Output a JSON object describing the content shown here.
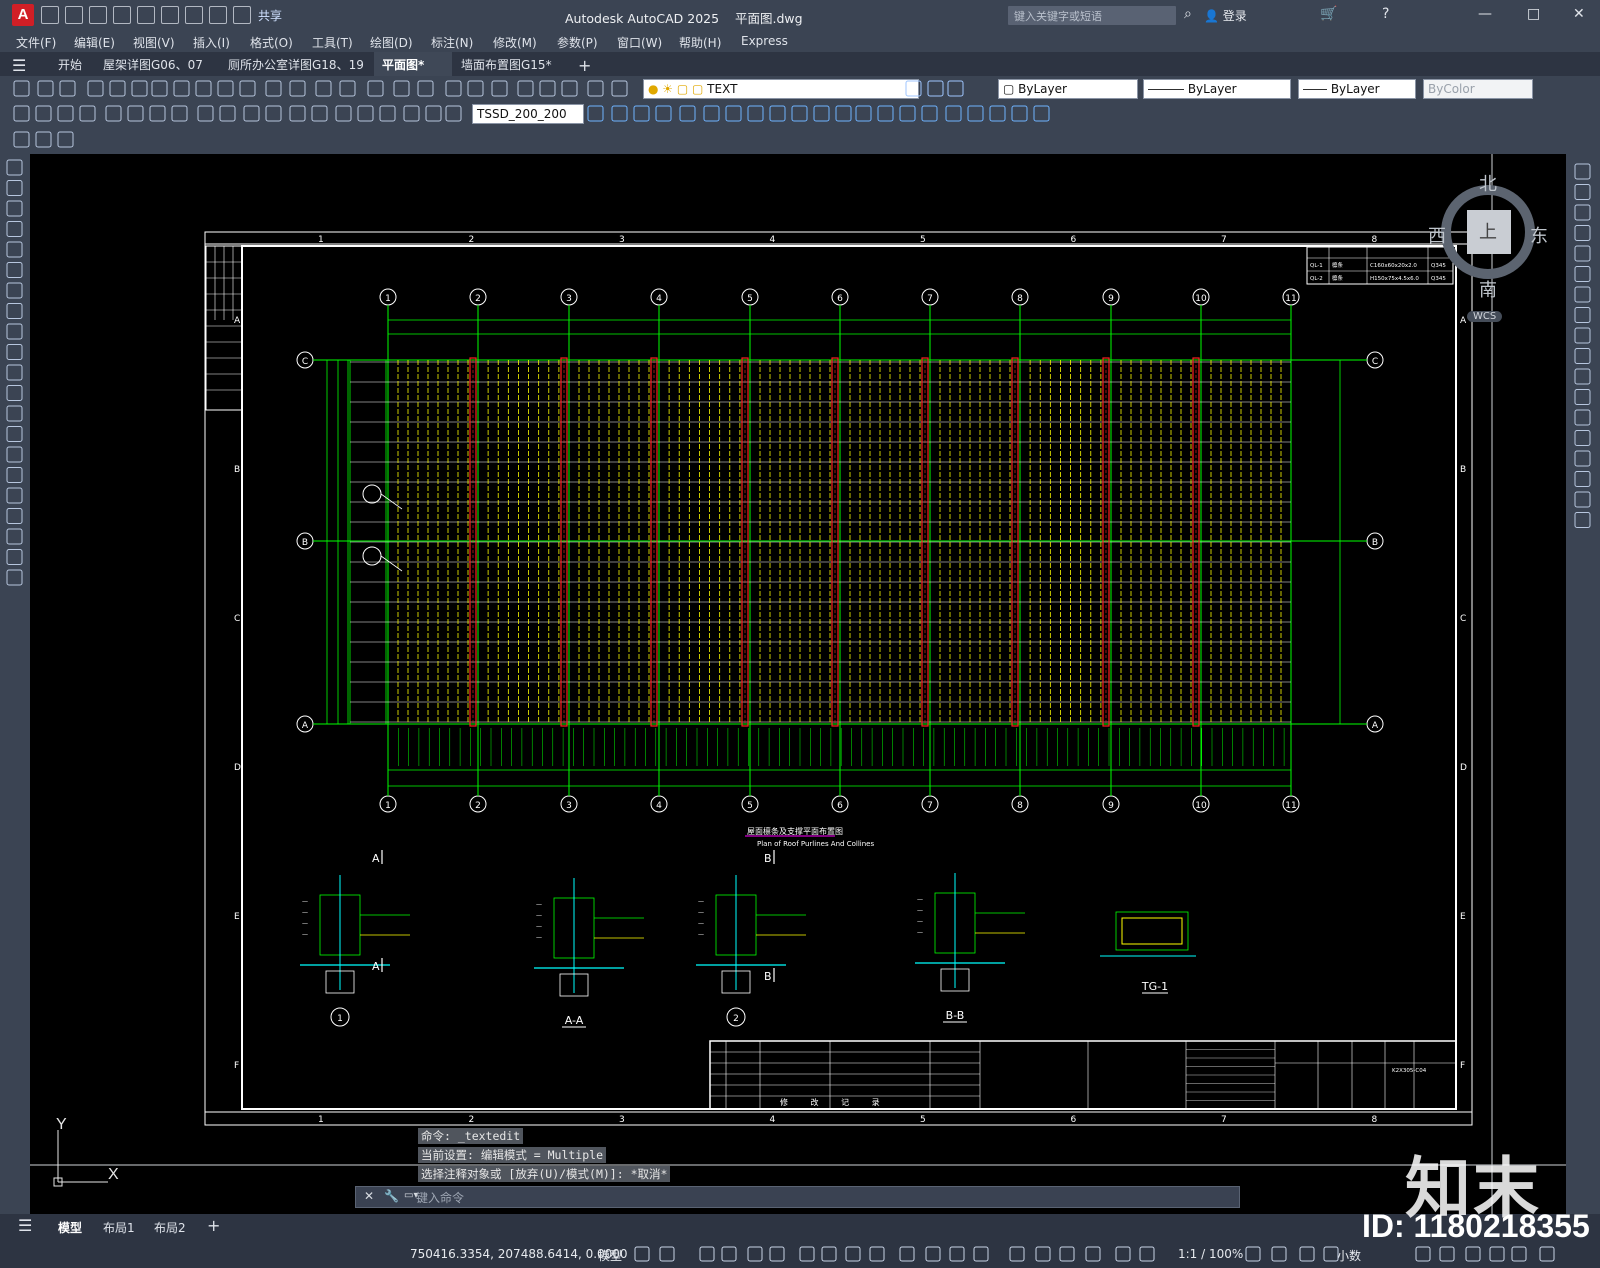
{
  "app": {
    "title": "Autodesk AutoCAD 2025",
    "file": "平面图.dwg",
    "share_label": "共享",
    "search_placeholder": "键入关键字或短语",
    "login_label": "登录"
  },
  "menu": [
    "文件(F)",
    "编辑(E)",
    "视图(V)",
    "插入(I)",
    "格式(O)",
    "工具(T)",
    "绘图(D)",
    "标注(N)",
    "修改(M)",
    "参数(P)",
    "窗口(W)",
    "帮助(H)",
    "Express"
  ],
  "doc_tabs": [
    {
      "label": "开始",
      "active": false
    },
    {
      "label": "屋架详图G06、07",
      "active": false
    },
    {
      "label": "厕所办公室详图G18、19",
      "active": false
    },
    {
      "label": "平面图*",
      "active": true
    },
    {
      "label": "墙面布置图G15*",
      "active": false
    }
  ],
  "toolbar": {
    "layer_value": "TEXT",
    "color_value": "ByLayer",
    "linetype_value": "ByLayer",
    "lineweight_value": "ByLayer",
    "plotstyle_value": "ByColor",
    "dimstyle_value": "TSSD_200_200"
  },
  "viewcube": {
    "north": "北",
    "south": "南",
    "east": "东",
    "west": "西",
    "top": "上",
    "wcs": "WCS"
  },
  "ucs": {
    "x": "X",
    "y": "Y"
  },
  "command": {
    "history": [
      "命令: _textedit",
      "当前设置: 编辑模式 = Multiple",
      "选择注释对象或 [放弃(U)/模式(M)]: *取消*"
    ],
    "placeholder": "键入命令"
  },
  "layout_tabs": [
    {
      "label": "模型",
      "active": true
    },
    {
      "label": "布局1",
      "active": false
    },
    {
      "label": "布局2",
      "active": false
    }
  ],
  "status": {
    "coordinates": "750416.3354, 207488.6414, 0.0000",
    "space": "模型",
    "scale": "1:1 / 100%",
    "units": "小数"
  },
  "drawing": {
    "grid_top": [
      "1",
      "2",
      "3",
      "4",
      "5",
      "6",
      "7",
      "8",
      "9",
      "10",
      "11"
    ],
    "grid_side": [
      "C",
      "B",
      "A"
    ],
    "frame_cols": [
      "1",
      "2",
      "3",
      "4",
      "5",
      "6",
      "7",
      "8"
    ],
    "frame_rows": [
      "A",
      "B",
      "C",
      "D",
      "E",
      "F"
    ],
    "plan_title": "屋面檩条及支撑平面布置图",
    "plan_subtitle": "Plan of Roof Purlines And Collines",
    "details": [
      "1",
      "A-A",
      "2",
      "B-B",
      "TG-1"
    ],
    "section_marks": [
      "A",
      "A",
      "B",
      "B"
    ],
    "revision_label": "修 改 记 录",
    "drawing_no": "K2X305-C04",
    "legend_rows": [
      [
        "QL-1",
        "檩条",
        "C160x60x20x2.0",
        "Q345"
      ],
      [
        "QL-2",
        "檩条",
        "H150x75x4.5x6.0",
        "Q345"
      ]
    ]
  },
  "watermark": {
    "logo": "知末",
    "id": "ID: 1180218355"
  }
}
